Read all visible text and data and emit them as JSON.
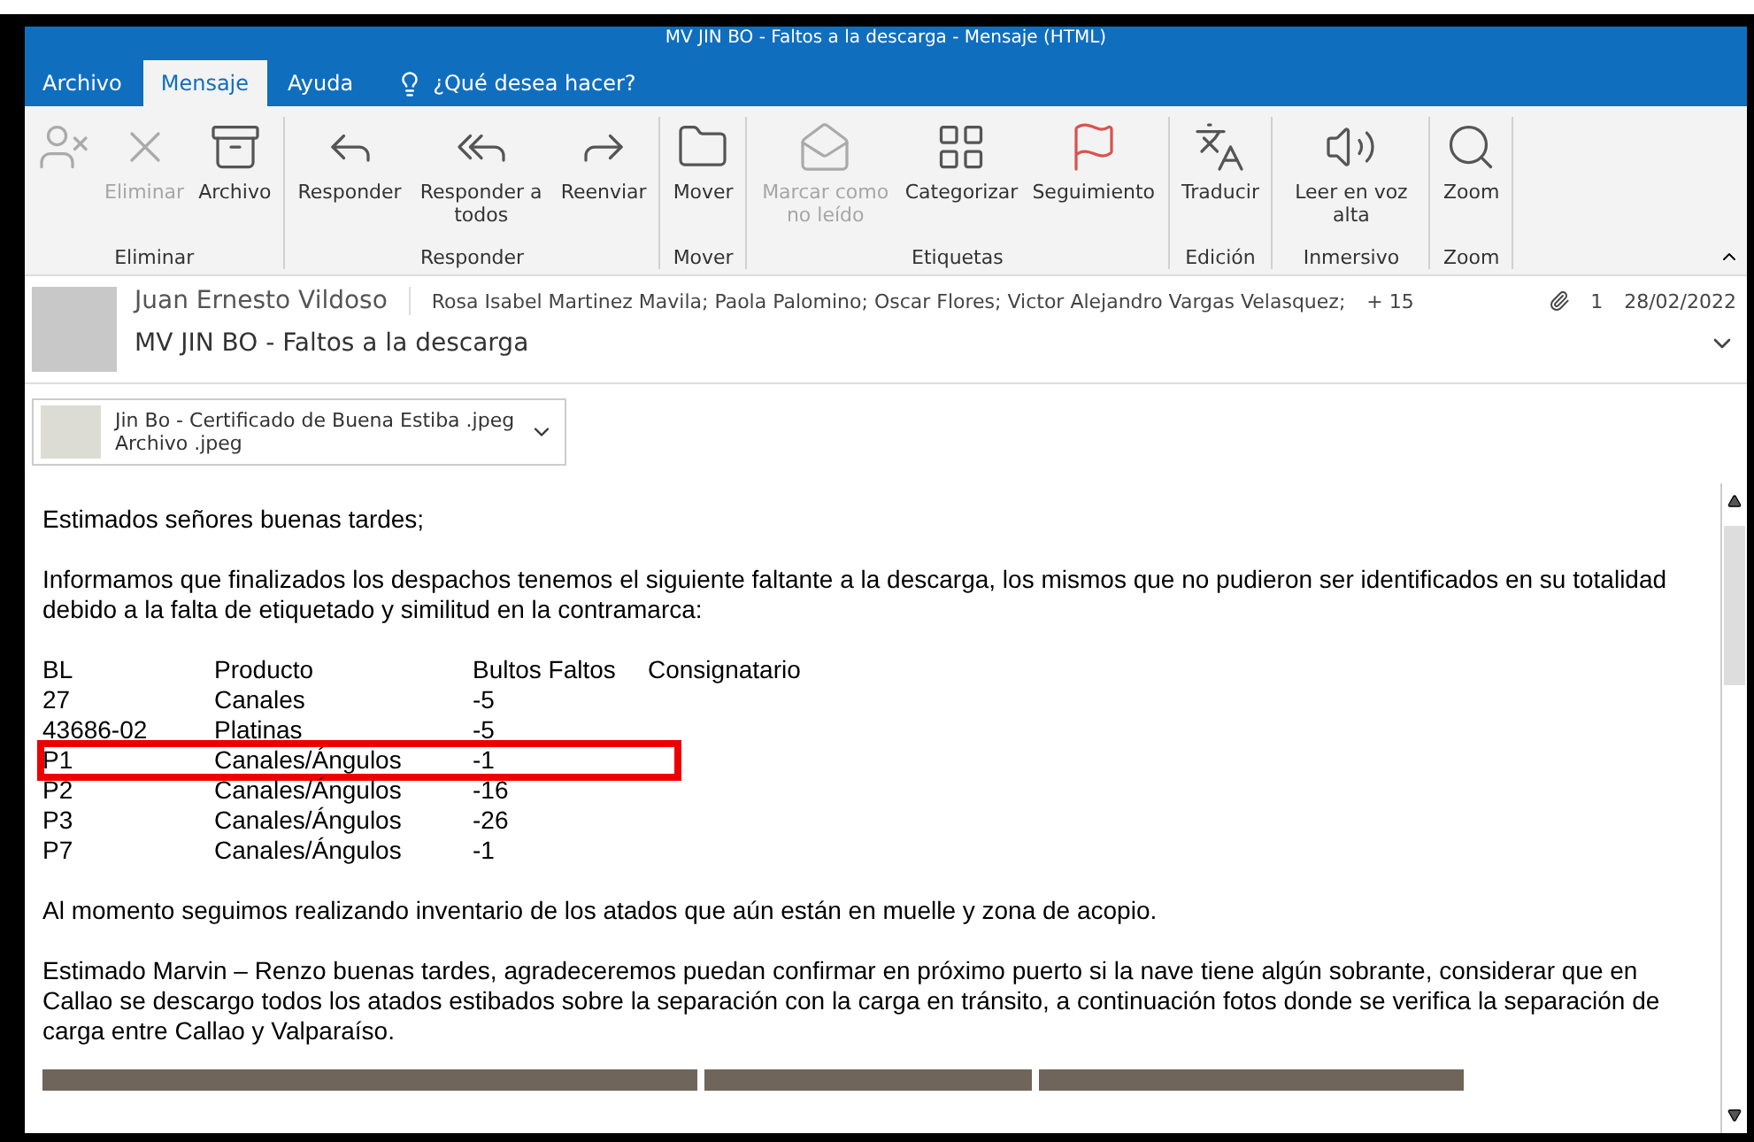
{
  "window": {
    "title": "MV JIN BO - Faltos a la descarga - Mensaje (HTML)"
  },
  "tabs": [
    {
      "label": "Archivo",
      "selected": false
    },
    {
      "label": "Mensaje",
      "selected": true
    },
    {
      "label": "Ayuda",
      "selected": false
    }
  ],
  "tell_me": {
    "placeholder": "¿Qué desea hacer?"
  },
  "ribbon": [
    {
      "name": "Eliminar",
      "buttons": [
        {
          "disabled": true
        },
        {
          "label": "Eliminar",
          "disabled": true
        },
        {
          "label": "Archivo",
          "disabled": false
        }
      ]
    },
    {
      "name": "Responder",
      "buttons": [
        {
          "label": "Responder",
          "disabled": false
        },
        {
          "label": "Responder a todos",
          "disabled": false
        },
        {
          "label": "Reenviar",
          "disabled": false
        }
      ]
    },
    {
      "name": "Mover",
      "buttons": [
        {
          "label": "Mover",
          "disabled": false
        }
      ]
    },
    {
      "name": "Etiquetas",
      "buttons": [
        {
          "label": "Marcar como no leído",
          "disabled": true
        },
        {
          "label": "Categorizar",
          "disabled": false
        },
        {
          "label": "Seguimiento",
          "disabled": false
        }
      ]
    },
    {
      "name": "Edición",
      "buttons": [
        {
          "label": "Traducir",
          "disabled": false
        }
      ]
    },
    {
      "name": "Inmersivo",
      "buttons": [
        {
          "label": "Leer en voz alta",
          "disabled": false
        }
      ]
    },
    {
      "name": "Zoom",
      "buttons": [
        {
          "label": "Zoom",
          "disabled": false
        }
      ]
    }
  ],
  "header": {
    "sender": "Juan Ernesto Vildoso",
    "recipients": "Rosa Isabel Martinez Mavila; Paola Palomino; Oscar Flores; Victor Alejandro Vargas Velasquez;",
    "more_recipients": "+ 15",
    "attachment_count": "1",
    "date": "28/02/2022",
    "subject": "MV JIN BO - Faltos a la descarga"
  },
  "attachment": {
    "name": "Jin Bo - Certificado de Buena Estiba .jpeg",
    "type": "Archivo .jpeg"
  },
  "body": {
    "greeting": "Estimados señores buenas tardes;",
    "intro": "Informamos que finalizados los despachos tenemos el siguiente faltante a la descarga, los mismos que no pudieron ser identificados en su totalidad debido a la falta de etiquetado y similitud en la contramarca:",
    "table": {
      "columns": [
        "BL",
        "Producto",
        "Bultos Faltos",
        "Consignatario"
      ],
      "rows": [
        {
          "cells": [
            "27",
            "Canales",
            "-5"
          ],
          "highlighted": false
        },
        {
          "cells": [
            "43686-02",
            "Platinas",
            "-5"
          ],
          "highlighted": false
        },
        {
          "cells": [
            "P1",
            "Canales/Ángulos",
            "-1"
          ],
          "highlighted": true
        },
        {
          "cells": [
            "P2",
            "Canales/Ángulos",
            "-16"
          ],
          "highlighted": false
        },
        {
          "cells": [
            "P3",
            "Canales/Ángulos",
            "-26"
          ],
          "highlighted": false
        },
        {
          "cells": [
            "P7",
            "Canales/Ángulos",
            "-1"
          ],
          "highlighted": false
        }
      ]
    },
    "paragraphs": [
      "Al momento seguimos realizando inventario de los atados que aún están en muelle y zona de acopio.",
      "Estimado Marvin – Renzo buenas tardes, agradeceremos puedan confirmar en próximo puerto si la nave tiene algún sobrante, considerar que en Callao se descargo todos los atados estibados sobre la separación con la carga en tránsito, a continuación fotos donde se verifica la separación de carga entre Callao y Valparaíso."
    ]
  }
}
